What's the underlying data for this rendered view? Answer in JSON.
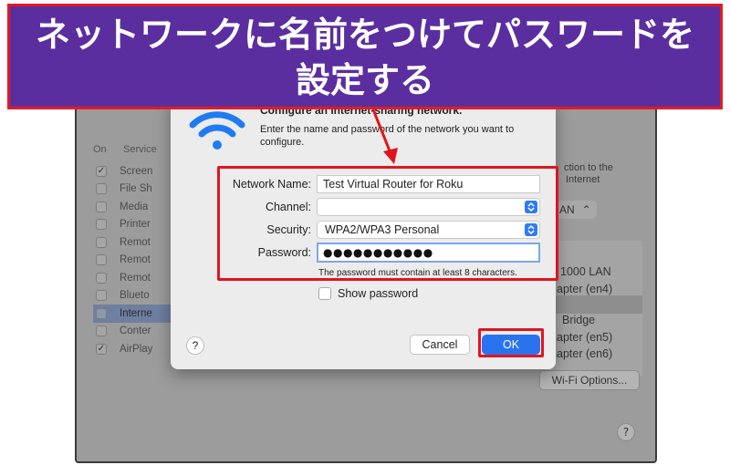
{
  "banner": {
    "line1": "ネットワークに名前をつけてパスワードを",
    "line2": "設定する"
  },
  "background": {
    "service_header_on": "On",
    "service_header_service": "Service",
    "services": [
      {
        "label": "Screen",
        "checked": true,
        "selected": false
      },
      {
        "label": "File Sh",
        "checked": false,
        "selected": false
      },
      {
        "label": "Media",
        "checked": false,
        "selected": false
      },
      {
        "label": "Printer",
        "checked": false,
        "selected": false
      },
      {
        "label": "Remot",
        "checked": false,
        "selected": false
      },
      {
        "label": "Remot",
        "checked": false,
        "selected": false
      },
      {
        "label": "Remot",
        "checked": false,
        "selected": false
      },
      {
        "label": "Blueto",
        "checked": false,
        "selected": false
      },
      {
        "label": "Interne",
        "checked": false,
        "selected": true
      },
      {
        "label": "Conter",
        "checked": false,
        "selected": false
      },
      {
        "label": "AirPlay",
        "checked": true,
        "selected": false
      }
    ],
    "right_text_1": "ction to the",
    "right_text_2": "Internet",
    "lan_popup": "AN",
    "ports": [
      "1000 LAN",
      "apter (en4)",
      "Bridge",
      "apter (en5)",
      "apter (en6)"
    ],
    "wifi_options": "Wi-Fi Options...",
    "help": "?"
  },
  "dialog": {
    "title": "Configure an internet-sharing network.",
    "description": "Enter the name and password of the network you want to configure.",
    "network_name_label": "Network Name:",
    "network_name_value": "Test Virtual Router for Roku",
    "channel_label": "Channel:",
    "channel_value": "",
    "security_label": "Security:",
    "security_value": "WPA2/WPA3 Personal",
    "password_label": "Password:",
    "password_value": "●●●●●●●●●●●",
    "password_hint": "The password must contain at least 8 characters.",
    "show_password_label": "Show password",
    "help_label": "?",
    "cancel_label": "Cancel",
    "ok_label": "OK"
  },
  "colors": {
    "banner_bg": "#5b2ea0",
    "highlight": "#e0141e",
    "accent_blue": "#2a73ee"
  }
}
